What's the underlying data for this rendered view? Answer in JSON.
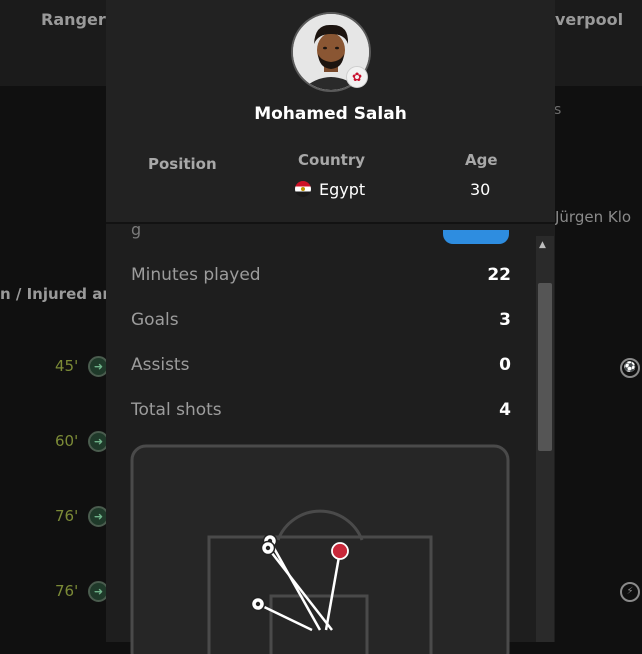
{
  "background": {
    "home_team": "Ranger",
    "away_team": "verpool",
    "partial_text": "s",
    "coach": "Jürgen Klo",
    "section_label": "n / Injured ar",
    "substitutions": [
      {
        "minute": "45'"
      },
      {
        "minute": "60'"
      },
      {
        "minute": "76'"
      },
      {
        "minute": "76'"
      }
    ]
  },
  "player": {
    "name": "Mohamed Salah",
    "club_badge_icon": "liverpool-badge-icon",
    "position_label": "Position",
    "country_label": "Country",
    "country": "Egypt",
    "age_label": "Age",
    "age": "30"
  },
  "stats": {
    "hidden_label": "g",
    "rows": [
      {
        "label": "Minutes played",
        "value": "22"
      },
      {
        "label": "Goals",
        "value": "3"
      },
      {
        "label": "Assists",
        "value": "0"
      },
      {
        "label": "Total shots",
        "value": "4"
      }
    ]
  },
  "shot_map": {
    "goal_color": "#ffffff",
    "miss_color": "#c8283a",
    "shots": [
      {
        "outcome": "goal",
        "icon": "soccer-ball-icon"
      },
      {
        "outcome": "goal",
        "icon": "soccer-ball-icon"
      },
      {
        "outcome": "goal",
        "icon": "soccer-ball-icon"
      },
      {
        "outcome": "miss",
        "icon": "shot-marker-icon"
      }
    ]
  },
  "colors": {
    "accent": "#2e8de0",
    "minute_text": "#7c8b37",
    "popup_bg": "#1e1e1e"
  }
}
